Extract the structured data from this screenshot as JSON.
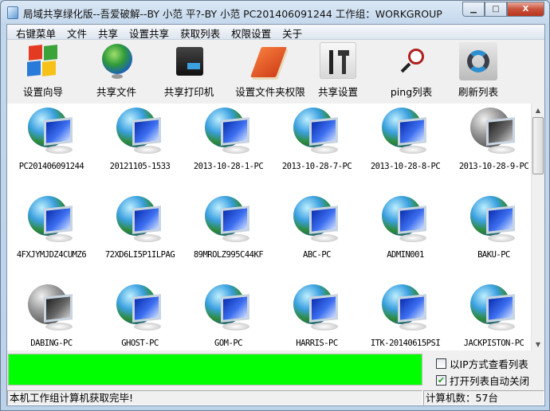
{
  "window": {
    "title": "局域共享绿化版--吾爱破解--BY 小范 平?-BY 小范 PC201406091244  工作组：WORKGROUP",
    "minimize": "▁",
    "maximize": "□",
    "close": "X"
  },
  "menu": [
    "右键菜单",
    "文件",
    "共享",
    "设置共享",
    "获取列表",
    "权限设置",
    "关于"
  ],
  "toolbar": [
    {
      "label": "设置向导",
      "icon": "windows-logo-icon"
    },
    {
      "label": "共享文件",
      "icon": "globe-icon"
    },
    {
      "label": "共享打印机",
      "icon": "printer-server-icon"
    },
    {
      "label": "设置文件夹权限",
      "icon": "book-icon"
    },
    {
      "label": "共享设置",
      "icon": "tools-icon"
    },
    {
      "label": "ping列表",
      "icon": "magnifier-icon"
    },
    {
      "label": "刷新列表",
      "icon": "refresh-icon"
    }
  ],
  "computers": [
    {
      "name": "PC201406091244",
      "online": true
    },
    {
      "name": "20121105-1533",
      "online": true
    },
    {
      "name": "2013-10-28-1-PC",
      "online": true
    },
    {
      "name": "2013-10-28-7-PC",
      "online": true
    },
    {
      "name": "2013-10-28-8-PC",
      "online": true
    },
    {
      "name": "2013-10-28-9-PC",
      "online": false
    },
    {
      "name": "4FXJYMJDZ4CUMZ6",
      "online": true
    },
    {
      "name": "72XD6LI5P1ILPAG",
      "online": true
    },
    {
      "name": "89MROLZ995C44KF",
      "online": true
    },
    {
      "name": "ABC-PC",
      "online": true
    },
    {
      "name": "ADMIN001",
      "online": true
    },
    {
      "name": "BAKU-PC",
      "online": true
    },
    {
      "name": "DABING-PC",
      "online": false
    },
    {
      "name": "GHOST-PC",
      "online": true
    },
    {
      "name": "GOM-PC",
      "online": true
    },
    {
      "name": "HARRIS-PC",
      "online": true
    },
    {
      "name": "ITK-20140615PSI",
      "online": true
    },
    {
      "name": "JACKPISTON-PC",
      "online": true
    }
  ],
  "progress": {
    "percent": 100,
    "color": "#00ff00"
  },
  "options": {
    "view_by_ip": {
      "label": "以IP方式查看列表",
      "checked": false
    },
    "auto_close": {
      "label": "打开列表自动关闭",
      "checked": true
    }
  },
  "status": {
    "message": "本机工作组计算机获取完毕!",
    "count": "计算机数：57台"
  }
}
